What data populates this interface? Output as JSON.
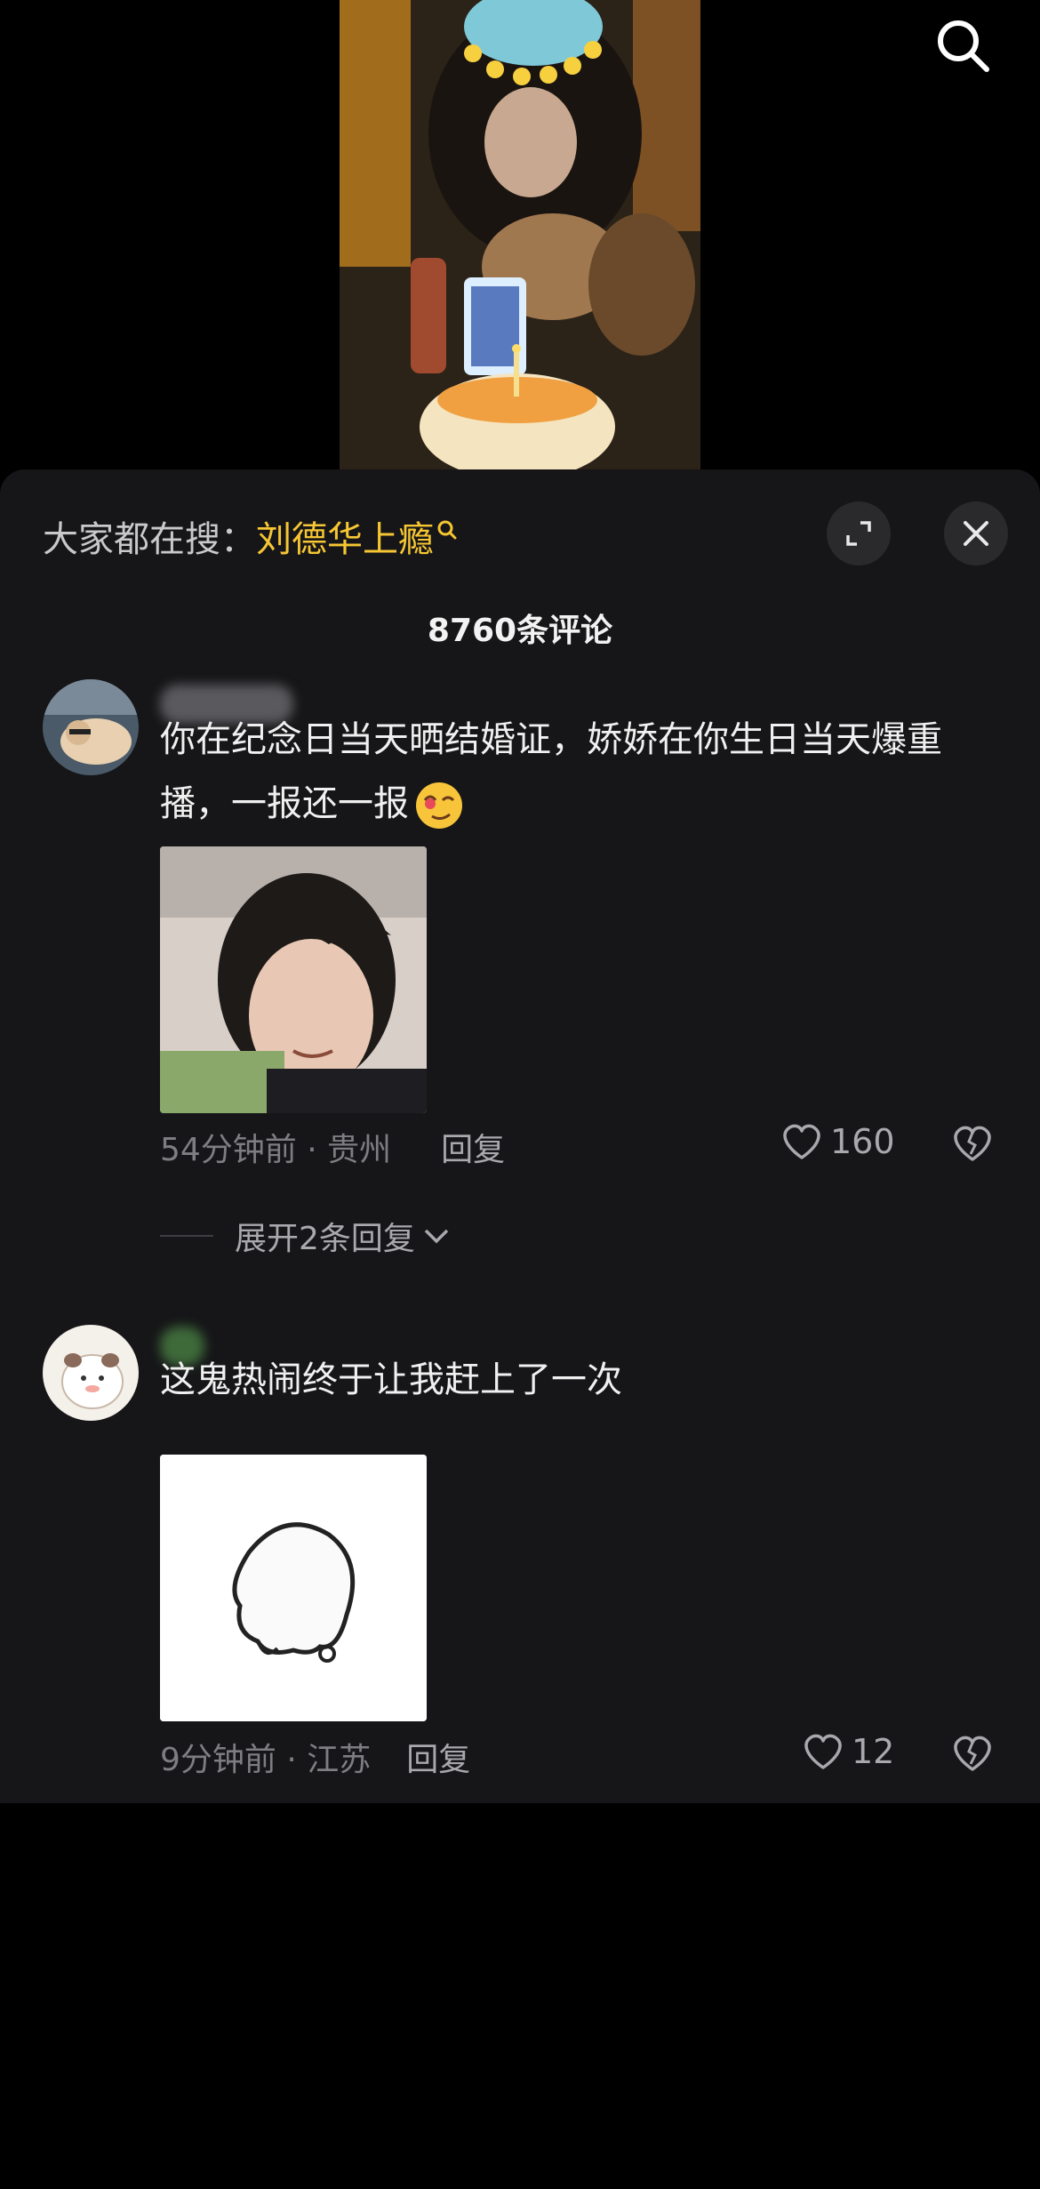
{
  "header": {
    "trending_prefix": "大家都在搜：",
    "trending_term": "刘德华上瘾"
  },
  "comments_count_title": "8760条评论",
  "comments": [
    {
      "text": "你在纪念日当天晒结婚证，娇娇在你生日当天爆重播，一报还一报",
      "time_location": "54分钟前 · 贵州",
      "reply_label": "回复",
      "likes": "160",
      "expand_label": "展开2条回复"
    },
    {
      "text": "这鬼热闹终于让我赶上了一次",
      "time_location": "9分钟前 · 江苏",
      "reply_label": "回复",
      "likes": "12"
    }
  ],
  "colors": {
    "panel_bg": "#161618",
    "accent_trending": "#f6c633",
    "muted_text": "#7d7d82"
  },
  "icons": [
    "search-icon",
    "trending-search-icon",
    "expand-icon",
    "close-icon",
    "like-icon",
    "dislike-icon",
    "chevron-down-icon",
    "emoji-icon"
  ]
}
